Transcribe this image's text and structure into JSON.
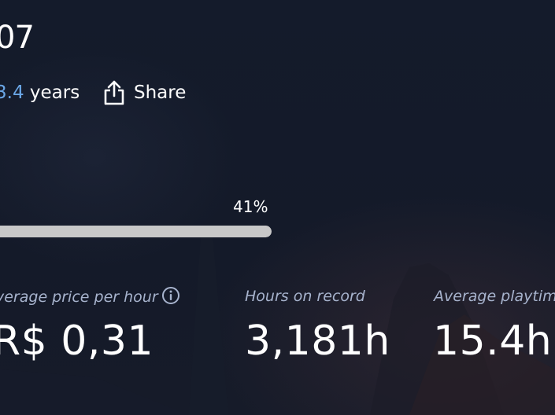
{
  "header": {
    "title_fragment": "07",
    "years_value": "3.4",
    "years_unit": "years",
    "share_label": "Share",
    "share_icon": "share-icon"
  },
  "progress": {
    "percent_label": "41%",
    "value": 0.41
  },
  "stats": [
    {
      "label": "verage price per hour",
      "value": "R$ 0,31",
      "icon": "info-icon"
    },
    {
      "label": "Hours on record",
      "value": "3,181h"
    },
    {
      "label": "Average playtim",
      "value": "15.4h"
    }
  ],
  "colors": {
    "background": "#131a2a",
    "accent_years": "#6aa6e6",
    "stat_label": "#a7b3cd",
    "progress_fill": "#c8c8c8",
    "text": "#ffffff"
  }
}
